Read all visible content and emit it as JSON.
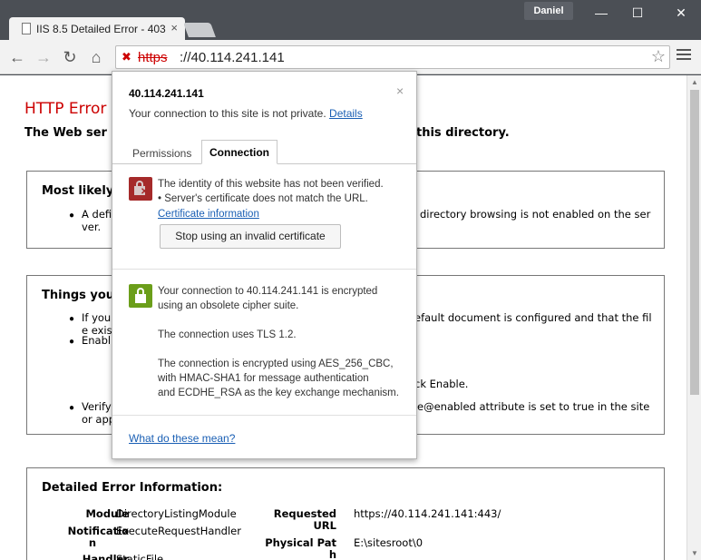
{
  "window": {
    "tab_title": "IIS 8.5 Detailed Error - 403",
    "tab_close": "×",
    "user": "Daniel",
    "minimize": "—",
    "maximize": "☐",
    "close": "✕"
  },
  "toolbar": {
    "back": "←",
    "forward": "→",
    "reload": "↻",
    "home": "⌂",
    "url_scheme": "https",
    "url_rest": "://40.114.241.141",
    "star": "☆"
  },
  "page": {
    "error_title": "HTTP Error",
    "error_sub_left": "The Web ser",
    "error_sub_right": "this directory.",
    "box1": {
      "heading": "Most likely",
      "line1_left": "A defi",
      "line1_right": "directory browsing is not enabled on the ser",
      "line2": "ver."
    },
    "box2": {
      "heading": "Things you",
      "b1_left": "If you",
      "b1_right": "efault document is configured and that the fil",
      "b1_cont": "e exis",
      "b2_left": "Enabl",
      "b2_mid": "ck Enable.",
      "b3_left": "Verify",
      "b3_right": "e@enabled attribute is set to true in the site",
      "b3_cont": "or app"
    },
    "details": {
      "heading": "Detailed Error Information:",
      "module_label": "Module",
      "module_value": "DirectoryListingModule",
      "notification_label_1": "Notificatio",
      "notification_label_2": "n",
      "notification_value": "ExecuteRequestHandler",
      "handler_label": "Handler",
      "handler_value": "StaticFile",
      "requested_label_1": "Requested",
      "requested_label_2": "URL",
      "requested_value": "https://40.114.241.141:443/",
      "physical_label_1": "Physical Pat",
      "physical_label_2": "h",
      "physical_value": "E:\\sitesroot\\0"
    }
  },
  "popup": {
    "host": "40.114.241.141",
    "close": "×",
    "not_private": "Your connection to this site is not private.",
    "details_link": "Details",
    "tab_permissions": "Permissions",
    "tab_connection": "Connection",
    "identity_line1": "The identity of this website has not been verified.",
    "identity_line2": "• Server's certificate does not match the URL.",
    "cert_link": "Certificate information",
    "stop_button": "Stop using an invalid certificate",
    "enc_line1": "Your connection to 40.114.241.141 is encrypted",
    "enc_line2": "using an obsolete cipher suite.",
    "tls": "The connection uses TLS 1.2.",
    "cipher_line1": "The connection is encrypted using AES_256_CBC,",
    "cipher_line2": "with HMAC-SHA1 for message authentication",
    "cipher_line3": "and ECDHE_RSA as the key exchange mechanism.",
    "what_link": "What do these mean?"
  }
}
